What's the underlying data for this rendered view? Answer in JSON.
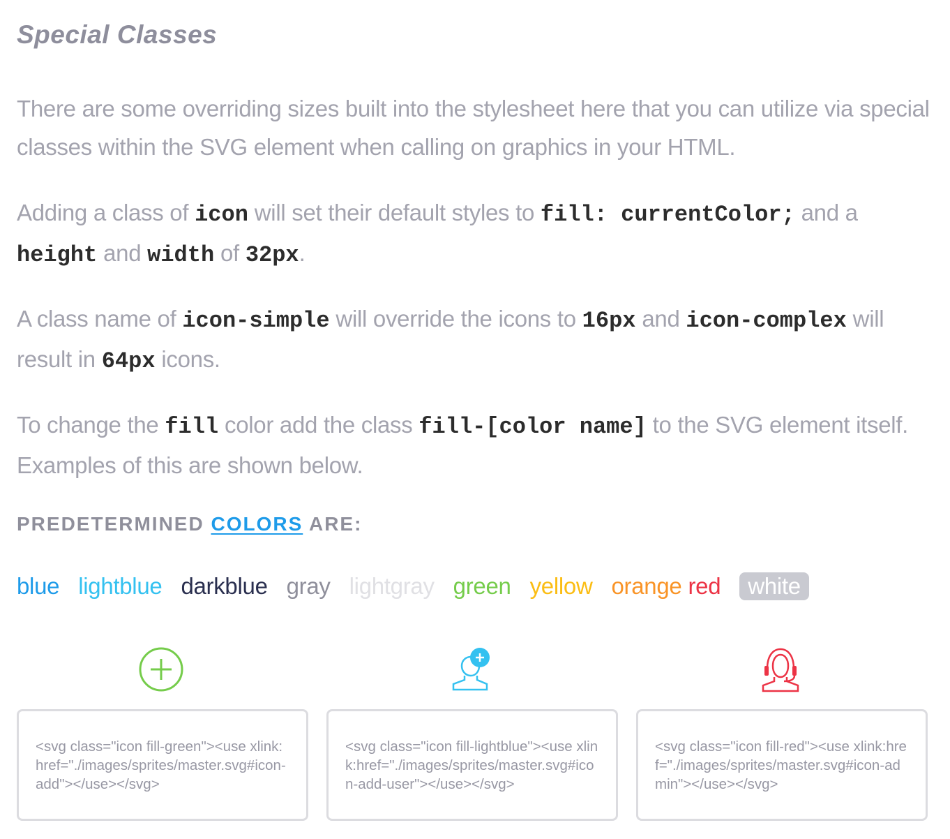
{
  "section": {
    "title": "Special Classes"
  },
  "paragraphs": {
    "intro": "There are some overriding sizes built into the stylesheet here that you can utilize via special classes within the SVG element when calling on graphics in your HTML.",
    "p2": {
      "t1": "Adding a class of ",
      "c1": "icon",
      "t2": " will set their default styles to ",
      "c2": "fill: currentColor;",
      "t3": " and a ",
      "c3": "height",
      "t4": " and ",
      "c4": "width",
      "t5": " of ",
      "c5": "32px",
      "t6": "."
    },
    "p3": {
      "t1": "A class name of ",
      "c1": "icon-simple",
      "t2": " will override the icons to ",
      "c2": "16px",
      "t3": " and ",
      "c3": "icon-complex",
      "t4": " will result in ",
      "c4": "64px",
      "t5": " icons."
    },
    "p4": {
      "t1": "To change the ",
      "c1": "fill",
      "t2": " color add the class ",
      "c2": "fill-[color name]",
      "t3": " to the SVG element itself. Examples of this are shown below."
    }
  },
  "colors_heading": {
    "before": "PREDETERMINED ",
    "link": "COLORS",
    "after": " ARE:"
  },
  "swatches": [
    {
      "label": "blue",
      "color": "#1e9be9"
    },
    {
      "label": "lightblue",
      "color": "#34c1f0"
    },
    {
      "label": "darkblue",
      "color": "#2a2f4f"
    },
    {
      "label": "gray",
      "color": "#8f8f9b"
    },
    {
      "label": "lightgray",
      "color": "#e0e0e4"
    },
    {
      "label": "green",
      "color": "#75cc4b"
    },
    {
      "label": "yellow",
      "color": "#fbbd14"
    },
    {
      "label": "orange",
      "color": "#f99427"
    },
    {
      "label": "red",
      "color": "#ec3345"
    },
    {
      "label": "white",
      "color": "#ffffff",
      "background": "#c9cad1"
    }
  ],
  "examples": [
    {
      "icon": "add-icon",
      "color": "#75cc4b",
      "code": "<svg class=\"icon fill-green\"><use xlink:href=\"./images/sprites/master.svg#icon-add\"></use></svg>"
    },
    {
      "icon": "add-user-icon",
      "color": "#34c1f0",
      "code": "<svg class=\"icon fill-lightblue\"><use xlink:href=\"./images/sprites/master.svg#icon-add-user\"></use></svg>"
    },
    {
      "icon": "admin-icon",
      "color": "#ec3345",
      "code": "<svg class=\"icon fill-red\"><use xlink:href=\"./images/sprites/master.svg#icon-admin\"></use></svg>"
    }
  ]
}
